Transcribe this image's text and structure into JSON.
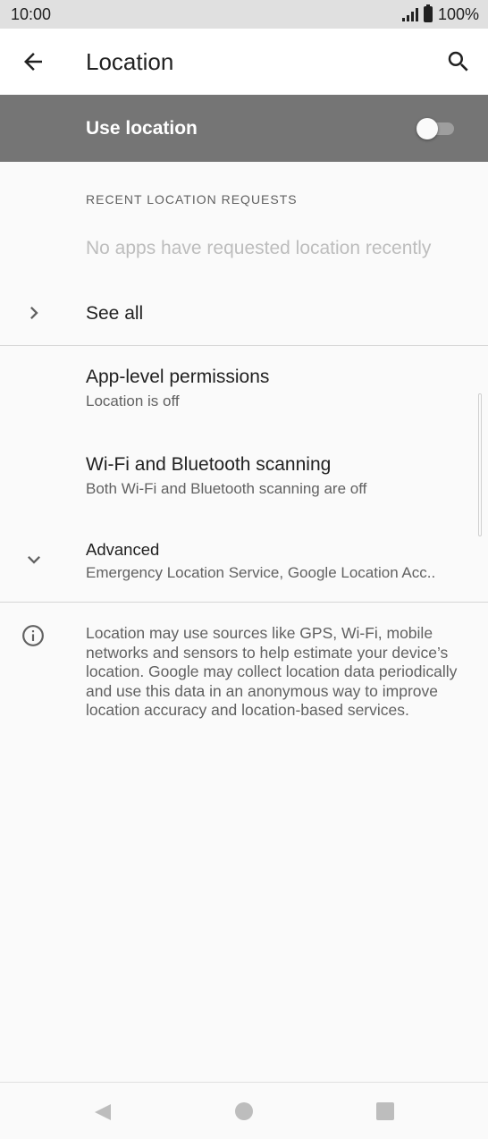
{
  "status_bar": {
    "time": "10:00",
    "battery": "100%",
    "icons": [
      "signal-icon",
      "battery-icon"
    ]
  },
  "app_bar": {
    "title": "Location",
    "back_icon": "arrow-back-icon",
    "search_icon": "search-icon"
  },
  "master_switch": {
    "label": "Use location",
    "state": "off",
    "background": "#757575"
  },
  "recent_requests": {
    "header": "RECENT LOCATION REQUESTS",
    "empty_text": "No apps have requested location recently",
    "see_all": "See all"
  },
  "settings": [
    {
      "title": "App-level permissions",
      "summary": "Location is off"
    },
    {
      "title": "Wi-Fi and Bluetooth scanning",
      "summary": "Both Wi-Fi and Bluetooth scanning are off"
    },
    {
      "title": "Advanced",
      "summary": "Emergency Location Service, Google Location Acc.."
    }
  ],
  "footer_info": {
    "icon": "info-icon",
    "text": "Location may use sources like GPS, Wi-Fi, mobile networks and sensors to help estimate your device’s location. Google may collect location data periodically and use this data in an anonymous way to improve location accuracy and location-based services."
  },
  "nav_bar": {
    "icons": [
      "nav-back-icon",
      "nav-home-icon",
      "nav-recents-icon"
    ]
  }
}
